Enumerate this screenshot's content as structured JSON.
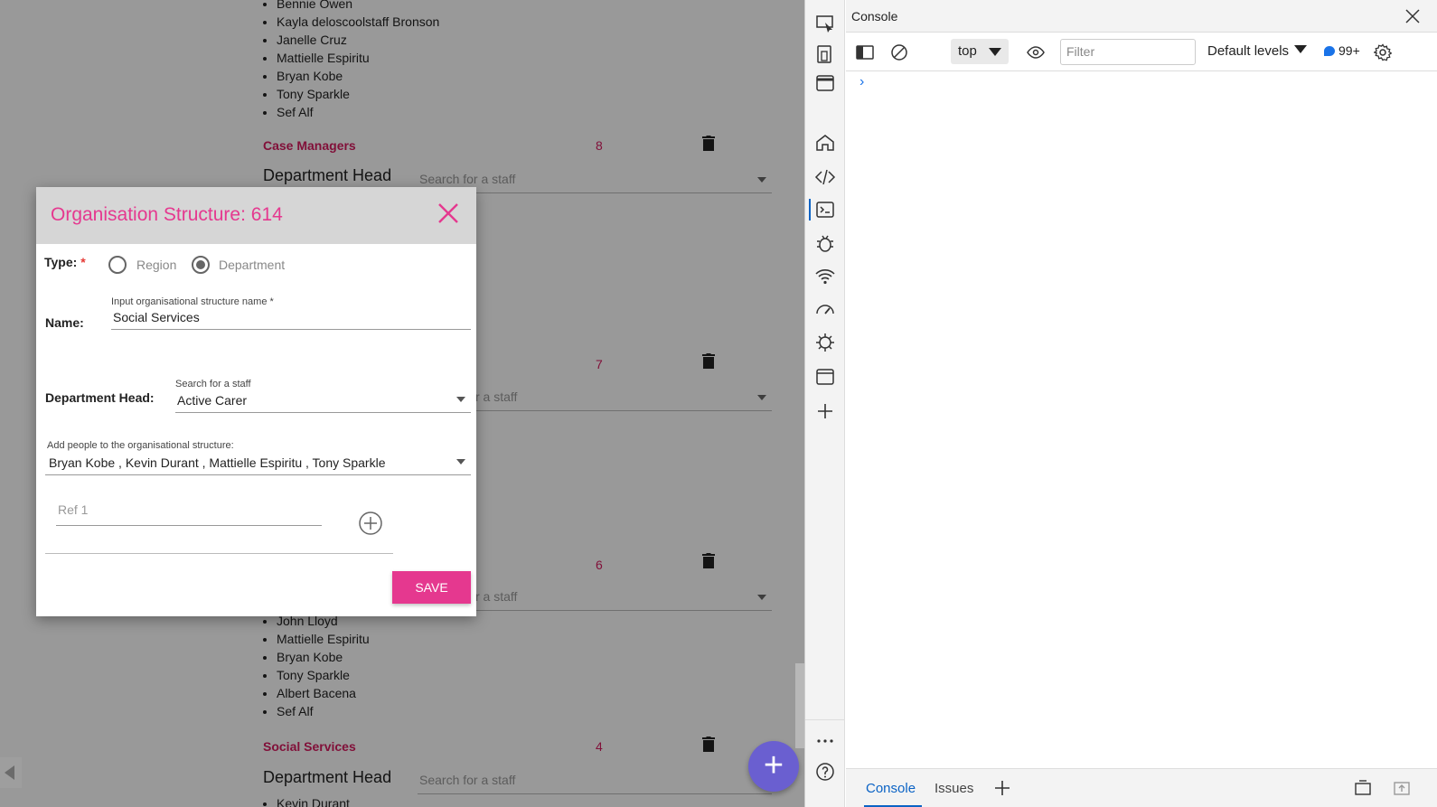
{
  "background": {
    "list_top": [
      "Bennie Owen",
      "Kayla deloscoolstaff Bronson",
      "Janelle Cruz",
      "Mattielle Espiritu",
      "Bryan Kobe",
      "Tony Sparkle",
      "Sef Alf"
    ],
    "group1": {
      "title": "Case Managers",
      "count": "8",
      "dept_head_label": "Department Head",
      "staff_placeholder": "Search for a staff"
    },
    "group2": {
      "count": "7",
      "staff_placeholder": "r a staff"
    },
    "group3": {
      "count": "6",
      "staff_placeholder": "r a staff"
    },
    "list_bottom": [
      "John Lloyd",
      "Mattielle Espiritu",
      "Bryan Kobe",
      "Tony Sparkle",
      "Albert Bacena",
      "Sef Alf"
    ],
    "group4": {
      "title": "Social Services",
      "count": "4",
      "dept_head_label": "Department Head",
      "staff_placeholder": "Search for a staff",
      "partial_item": "Kevin Durant"
    },
    "fab_label": "+"
  },
  "dialog": {
    "title": "Organisation Structure: 614",
    "type_label": "Type:",
    "required_mark": "*",
    "radio_region": "Region",
    "radio_department": "Department",
    "selected_type": "Department",
    "name_label": "Name:",
    "name_hint": "Input organisational structure name *",
    "name_value": "Social Services",
    "dept_head_label": "Department Head:",
    "dept_head_hint": "Search for a staff",
    "dept_head_value": "Active Carer",
    "people_hint": "Add people to the organisational structure:",
    "people_value": "Bryan Kobe , Kevin Durant , Mattielle Espiritu , Tony Sparkle",
    "ref_placeholder": "Ref 1",
    "save_label": "SAVE"
  },
  "devtools": {
    "panel_title": "Console",
    "context": "top",
    "filter_placeholder": "Filter",
    "levels": "Default levels",
    "message_count": "99+",
    "prompt": "›",
    "bottom_tabs": [
      "Console",
      "Issues"
    ],
    "active_bottom_tab": "Console",
    "add_tab": "+"
  },
  "colors": {
    "accent": "#e5388f",
    "fab": "#6a5fd0",
    "devtools_blue": "#0b63c5"
  }
}
